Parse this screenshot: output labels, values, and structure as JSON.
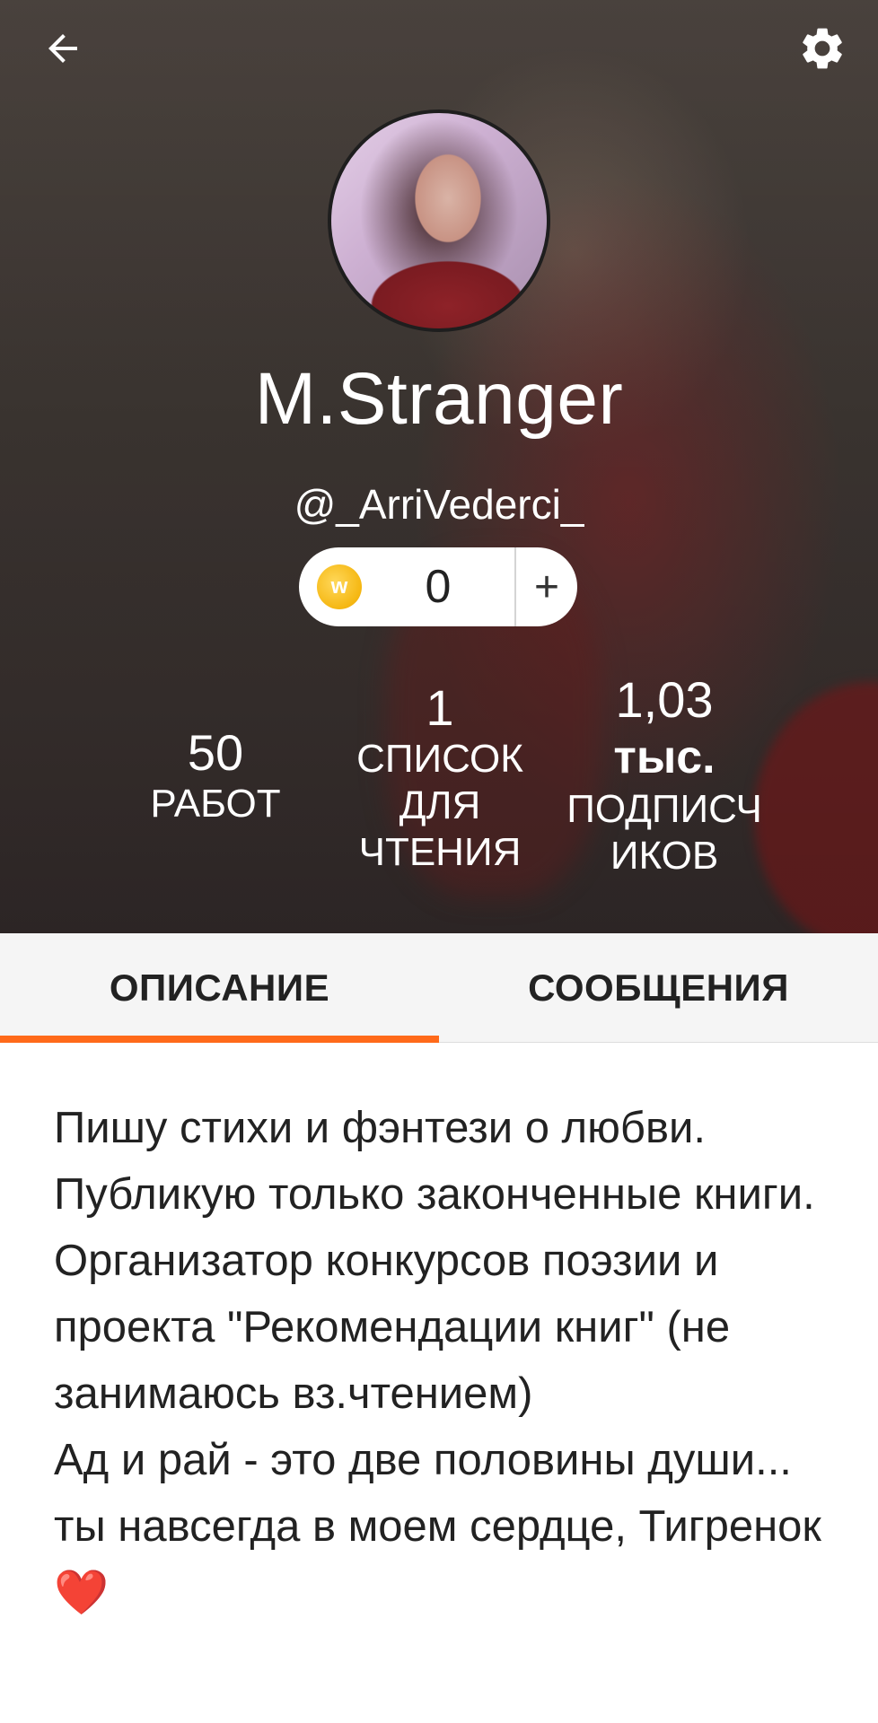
{
  "profile": {
    "name": "M.Stranger",
    "handle": "@_ArriVederci_"
  },
  "coins": {
    "count": "0",
    "add_label": "+",
    "icon": "wattpad-coin-icon"
  },
  "stats": {
    "works": {
      "value": "50",
      "label": "РАБОТ"
    },
    "reading_lists": {
      "value": "1",
      "label": "СПИСОК ДЛЯ ЧТЕНИЯ"
    },
    "followers": {
      "value": "1,03",
      "value_unit": "тыс.",
      "label": "ПОДПИСЧ ИКОВ"
    }
  },
  "tabs": [
    {
      "label": "ОПИСАНИЕ",
      "active": true
    },
    {
      "label": "СООБЩЕНИЯ",
      "active": false
    }
  ],
  "description": {
    "text": "Пишу стихи и фэнтези о любви. Публикую только законченные книги. Организатор конкурсов поэзии и проекта \"Рекомендации книг\" (не занимаюсь вз.чтением)\nАд и рай - это две половины души...\nты навсегда в моем сердце, Тигренок",
    "emoji": "❤️"
  },
  "colors": {
    "accent": "#ff6a1a",
    "tab_bg": "#f5f5f5",
    "text": "#222222"
  },
  "icons": {
    "back": "arrow-back-icon",
    "settings": "gear-icon"
  }
}
